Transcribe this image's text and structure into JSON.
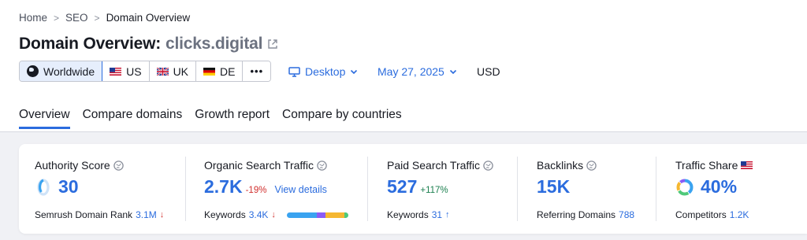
{
  "breadcrumb": [
    "Home",
    "SEO",
    "Domain Overview"
  ],
  "title": {
    "prefix": "Domain Overview:",
    "domain": "clicks.digital"
  },
  "databases": [
    {
      "label": "Worldwide",
      "icon": "globe-icon",
      "active": true
    },
    {
      "label": "US",
      "icon": "flag-us-icon"
    },
    {
      "label": "UK",
      "icon": "flag-uk-icon"
    },
    {
      "label": "DE",
      "icon": "flag-de-icon"
    },
    {
      "label": "•••",
      "icon": "more-icon"
    }
  ],
  "device": "Desktop",
  "date": "May 27, 2025",
  "currency": "USD",
  "tabs": [
    "Overview",
    "Compare domains",
    "Growth report",
    "Compare by countries"
  ],
  "metrics": {
    "authority": {
      "label": "Authority Score",
      "value": "30",
      "sub_label": "Semrush Domain Rank",
      "sub_value": "3.1M",
      "sub_arrow": "↓"
    },
    "organic": {
      "label": "Organic Search Traffic",
      "value": "2.7K",
      "delta": "-19%",
      "link": "View details",
      "sub_label": "Keywords",
      "sub_value": "3.4K",
      "sub_arrow": "↓"
    },
    "paid": {
      "label": "Paid Search Traffic",
      "value": "527",
      "delta": "+117%",
      "sub_label": "Keywords",
      "sub_value": "31",
      "sub_arrow": "↑"
    },
    "backlinks": {
      "label": "Backlinks",
      "value": "15K",
      "sub_label": "Referring Domains",
      "sub_value": "788"
    },
    "traffic_share": {
      "label": "Traffic Share",
      "value": "40%",
      "sub_label": "Competitors",
      "sub_value": "1.2K"
    }
  },
  "colors": {
    "accent": "#2b6cde",
    "negative": "#d1302e",
    "positive": "#1a7f4e",
    "kw_bar": [
      "#3aa3f0",
      "#8a5cf6",
      "#f5b731",
      "#4fc97a"
    ]
  }
}
